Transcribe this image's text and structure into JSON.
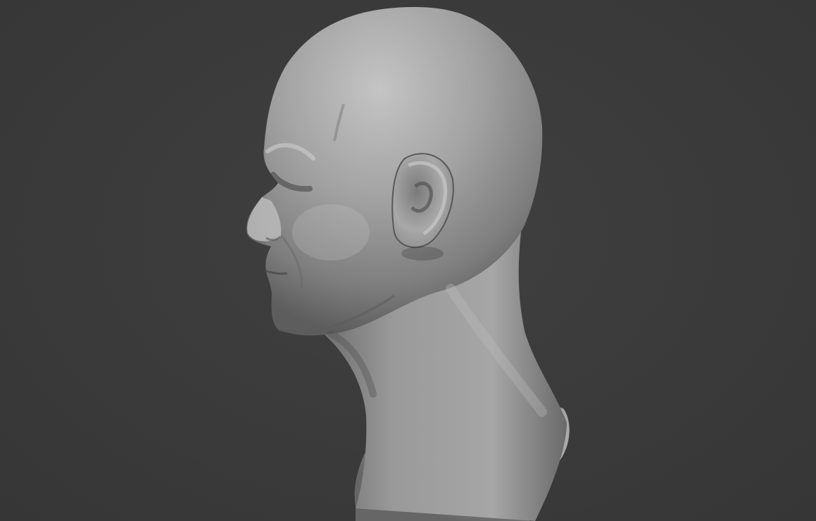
{
  "scene": {
    "subject": "head-bust-sculpt",
    "view": "left-profile",
    "colors": {
      "background": "#3b3b3b",
      "clay_light": "#bdbdbd",
      "clay_mid": "#8f8f8f",
      "clay_dark": "#4a4a4a"
    }
  }
}
